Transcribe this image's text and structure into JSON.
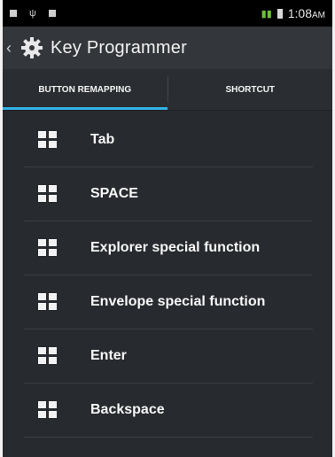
{
  "status_bar": {
    "time": "1:08",
    "ampm": "AM",
    "signal": "▮▮"
  },
  "app": {
    "title": "Key Programmer"
  },
  "tabs": [
    {
      "label": "BUTTON REMAPPING",
      "active": true
    },
    {
      "label": "SHORTCUT",
      "active": false
    }
  ],
  "items": [
    {
      "label": "Tab"
    },
    {
      "label": "SPACE"
    },
    {
      "label": "Explorer special function"
    },
    {
      "label": "Envelope special function"
    },
    {
      "label": "Enter"
    },
    {
      "label": "Backspace"
    }
  ],
  "colors": {
    "accent": "#32b4e8",
    "background": "#272a2e",
    "action_bar": "#33363a"
  }
}
